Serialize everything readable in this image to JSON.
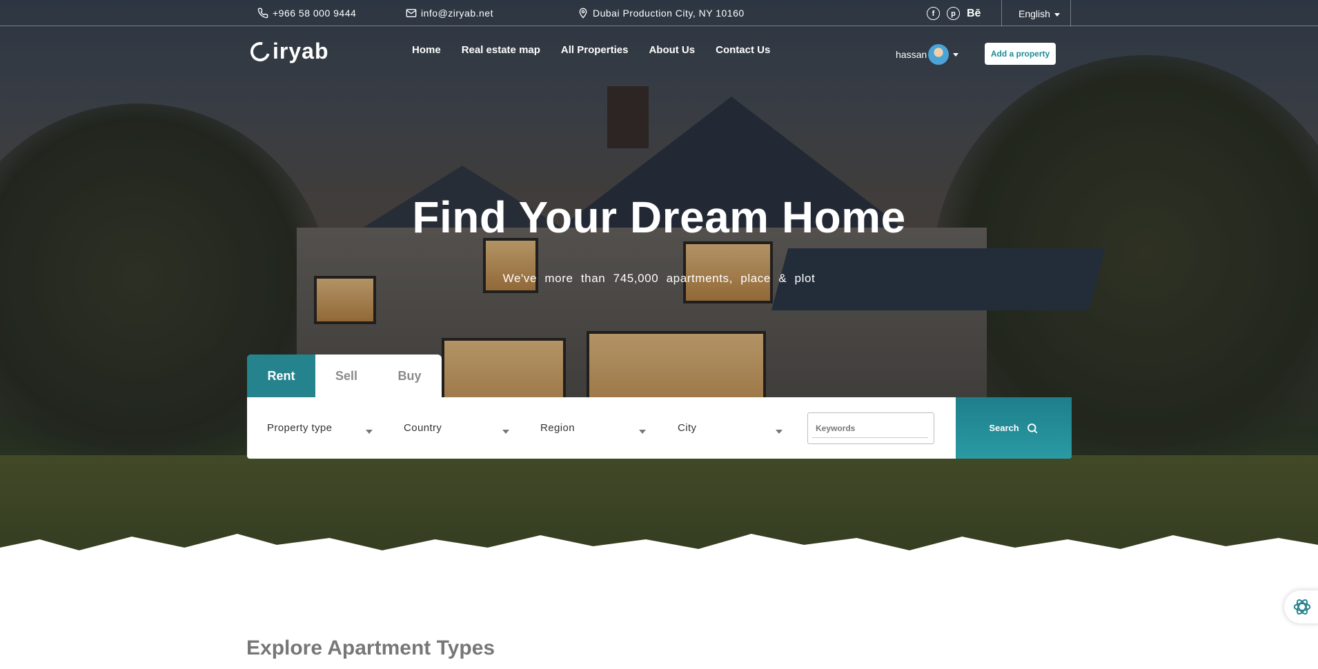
{
  "topbar": {
    "phone": "+966 58 000 9444",
    "email": "info@ziryab.net",
    "address": "Dubai Production City, NY 10160",
    "social": [
      {
        "icon": "facebook-icon",
        "glyph": "f"
      },
      {
        "icon": "pinterest-icon",
        "glyph": "p"
      },
      {
        "icon": "behance-icon",
        "glyph": "Bē"
      }
    ],
    "language": "English"
  },
  "nav": {
    "logo_text": "iryab",
    "menu": [
      "Home",
      "Real estate map",
      "All Properties",
      "About Us",
      "Contact Us"
    ],
    "user_name": "hassan",
    "add_property_label": "Add a property"
  },
  "hero": {
    "title": "Find Your Dream Home",
    "subtitle": "We've more than 745,000 apartments, place & plot"
  },
  "search": {
    "tabs": [
      "Rent",
      "Sell",
      "Buy"
    ],
    "active_tab": "Rent",
    "fields": [
      "Property type",
      "Country",
      "Region",
      "City"
    ],
    "keywords_placeholder": "Keywords",
    "button_label": "Search"
  },
  "section": {
    "title": "Explore Apartment Types"
  },
  "colors": {
    "accent": "#25838d",
    "button_text": "#1f8b95"
  }
}
